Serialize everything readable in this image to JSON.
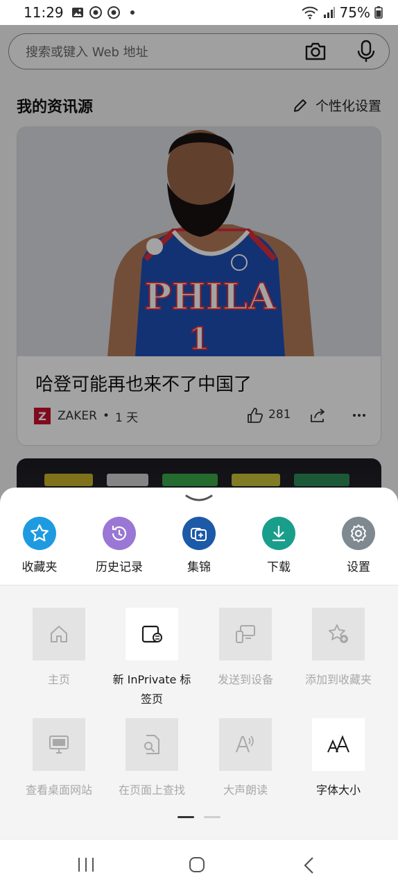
{
  "status_bar": {
    "time": "11:29",
    "battery": "75%"
  },
  "search": {
    "placeholder": "搜索或键入 Web 地址"
  },
  "feed": {
    "section_title": "我的资讯源",
    "personalize_label": "个性化设置",
    "card": {
      "jersey_text": "PHILA",
      "jersey_number": "1",
      "title": "哈登可能再也来不了中国了",
      "source_logo": "Z",
      "source": "ZAKER",
      "age": "1 天",
      "likes": "281"
    }
  },
  "sheet": {
    "quick_actions": [
      {
        "label": "收藏夹",
        "color": "#1e9be0"
      },
      {
        "label": "历史记录",
        "color": "#9a77d4"
      },
      {
        "label": "集锦",
        "color": "#1c5aa8"
      },
      {
        "label": "下载",
        "color": "#1a9e8c"
      },
      {
        "label": "设置",
        "color": "#7e8a90"
      }
    ],
    "tiles": [
      {
        "label": "主页"
      },
      {
        "label_line1": "新 InPrivate 标",
        "label_line2": "签页"
      },
      {
        "label": "发送到设备"
      },
      {
        "label": "添加到收藏夹"
      },
      {
        "label": "查看桌面网站"
      },
      {
        "label": "在页面上查找"
      },
      {
        "label": "大声朗读"
      },
      {
        "label": "字体大小"
      }
    ]
  }
}
